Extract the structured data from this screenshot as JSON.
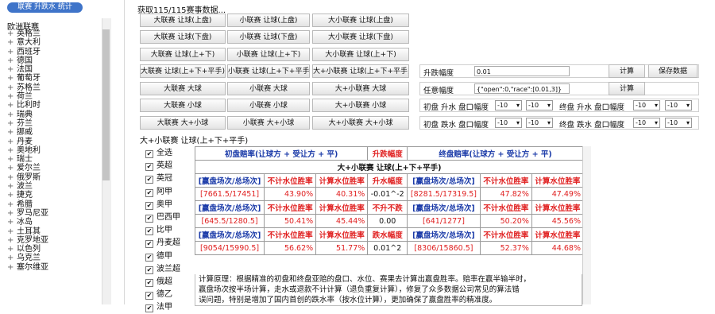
{
  "sidebar": {
    "top_button": "联赛 升跌水 统计",
    "header": "欧洲联赛",
    "leagues": [
      "英格兰",
      "意大利",
      "西班牙",
      "德国",
      "法国",
      "葡萄牙",
      "苏格兰",
      "荷兰",
      "比利时",
      "瑞典",
      "芬兰",
      "挪威",
      "丹麦",
      "奥地利",
      "瑞士",
      "爱尔兰",
      "俄罗斯",
      "波兰",
      "捷克",
      "希腊",
      "罗马尼亚",
      "冰岛",
      "土耳其",
      "克罗地亚",
      "以色列",
      "乌克兰",
      "塞尔维亚"
    ]
  },
  "status": "获取115/115赛事数据...",
  "buttons": [
    [
      "大联赛 让球(上盘)",
      "小联赛 让球(上盘)",
      "大小联赛 让球(上盘)"
    ],
    [
      "大联赛 让球(下盘)",
      "小联赛 让球(下盘)",
      "大小联赛 让球(下盘)"
    ],
    [
      "大联赛 让球(上+下)",
      "小联赛 让球(上+下)",
      "大小联赛 让球(上+下)"
    ],
    [
      "大联赛 让球(上+下+平手)",
      "小联赛 让球(上+下+平手)",
      "大+小联赛 让球(上+下+平手)"
    ],
    [
      "大联赛 大球",
      "小联赛 大球",
      "大+小联赛 大球"
    ],
    [
      "大联赛 小球",
      "小联赛 小球",
      "大+小联赛 小球"
    ],
    [
      "大联赛 大+小球",
      "小联赛 大+小球",
      "大+小联赛 大+小球"
    ]
  ],
  "controls": {
    "rise_label": "升跌幅度",
    "rise_value": "0.01",
    "calc_label": "计算",
    "save_label": "保存数据",
    "range_label": "任意幅度",
    "range_value": "{\"open\":0,\"race\":[0.01,3]}",
    "calc2_label": "计算",
    "rise_row": {
      "a": "初盘 升水 盘口幅度",
      "s1": "-10",
      "s2": "-10",
      "b": "终盘 升水 盘口幅度",
      "s3": "-10",
      "s4": "-10"
    },
    "fall_row": {
      "a": "初盘 跌水 盘口幅度",
      "s1": "-10",
      "s2": "-10",
      "b": "终盘 跌水 盘口幅度",
      "s3": "-10",
      "s4": "-10"
    }
  },
  "section_title": "大+小联赛 让球(上+下+平手)",
  "checklist": [
    {
      "label": "全选",
      "checked": true
    },
    {
      "label": "英超",
      "checked": true
    },
    {
      "label": "英冠",
      "checked": true
    },
    {
      "label": "阿甲",
      "checked": true
    },
    {
      "label": "奥甲",
      "checked": true
    },
    {
      "label": "巴西甲",
      "checked": true
    },
    {
      "label": "比甲",
      "checked": true
    },
    {
      "label": "丹麦超",
      "checked": true
    },
    {
      "label": "德甲",
      "checked": true
    },
    {
      "label": "波兰超",
      "checked": true
    },
    {
      "label": "俄超",
      "checked": true
    },
    {
      "label": "德乙",
      "checked": true
    },
    {
      "label": "法甲",
      "checked": true
    }
  ],
  "table": {
    "head_left": "初盘赔率(让球方 + 受让方 + 平)",
    "head_mid": "升跌幅度",
    "head_right": "终盘赔率(让球方 + 受让方 + 平)",
    "subtitle": "大+小联赛 让球(上+下+平手)",
    "col_a": "[赢盘场次/总场次]",
    "col_b": "不计水位胜率",
    "col_c": "计算水位胜率",
    "blocks": [
      {
        "mid_head": "升水幅度",
        "l": "[7661.5/17451]",
        "lb": "43.90%",
        "lc": "40.31%",
        "m": "-0.01^-2",
        "r": "[8281.5/17319.5]",
        "rb": "47.82%",
        "rc": "47.49%"
      },
      {
        "mid_head": "不升不跌",
        "l": "[645.5/1280.5]",
        "lb": "50.41%",
        "lc": "45.44%",
        "m": "0.00",
        "r": "[641/1277]",
        "rb": "50.20%",
        "rc": "45.56%"
      },
      {
        "mid_head": "跌水幅度",
        "l": "[9054/15990.5]",
        "lb": "56.62%",
        "lc": "51.77%",
        "m": "0.01^2",
        "r": "[8306/15860.5]",
        "rb": "52.37%",
        "rc": "44.68%"
      }
    ]
  },
  "notes": [
    "计算原理：根据精准的初盘和终盘亚赔的盘口、水位、赛果去计算出赢盘胜率。赔率在赢半输半时，",
    "赢盘场次按半场计算，走水或退款不计计算（退负重复计算），修复了众多数据公司常见的算法错",
    "误问题，特别是增加了国内首创的跌水率（按水位计算），更加确保了赢盘胜率的精准度。"
  ]
}
